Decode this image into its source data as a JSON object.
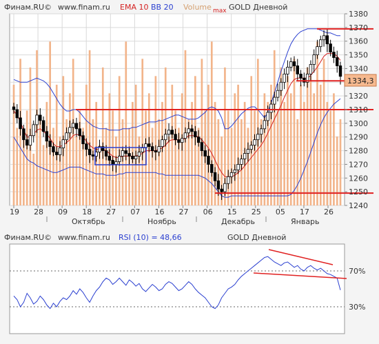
{
  "colors": {
    "background": "#f4f4f4",
    "plot_bg": "#ffffff",
    "grid": "#d9d9d9",
    "axis": "#888888",
    "text": "#333333",
    "ema": "#d42020",
    "bb": "#2a3fd0",
    "volume": "#f2b48a",
    "support_line": "#e02020",
    "rsi": "#2a3fd0",
    "highlight_box": "#2a3fd0",
    "price_box_bg": "#f6b98f"
  },
  "price_panel": {
    "header": {
      "site1": "Финам.RU©",
      "site2": "www.finam.ru",
      "ema_label": "EMA 10",
      "bb_label": "BB 20",
      "volume_label": "Volume",
      "max_label": "max",
      "instrument": "GOLD Дневной"
    },
    "last_price": "1334,3",
    "y_ticks": [
      "1380",
      "1370",
      "1360",
      "1350",
      "1340",
      "1330",
      "1320",
      "1310",
      "1300",
      "1290",
      "1280",
      "1270",
      "1260",
      "1250",
      "1240"
    ],
    "x_day_ticks": [
      "19",
      "28",
      "09",
      "18",
      "27",
      "07",
      "16",
      "27",
      "06",
      "15",
      "25",
      "05",
      "17",
      "26"
    ],
    "x_month_labels": [
      "Октябрь",
      "Ноябрь",
      "Декабрь",
      "Январь"
    ]
  },
  "rsi_panel": {
    "header": {
      "site1": "Финам.RU©",
      "site2": "www.finam.ru",
      "rsi_label": "RSI (10) = 48,66",
      "instrument": "GOLD Дневной"
    },
    "levels": [
      "70%",
      "30%"
    ]
  },
  "chart_data": [
    {
      "type": "candlestick",
      "title": "GOLD Дневной",
      "ylim": [
        1240,
        1380
      ],
      "x_ticks": [
        "19",
        "28",
        "09",
        "18",
        "27",
        "07",
        "16",
        "27",
        "06",
        "15",
        "25",
        "05",
        "17",
        "26"
      ],
      "months": [
        "Октябрь",
        "Ноябрь",
        "Декабрь",
        "Январь"
      ],
      "closes": [
        1310,
        1304,
        1296,
        1288,
        1284,
        1291,
        1299,
        1306,
        1302,
        1294,
        1287,
        1283,
        1279,
        1277,
        1282,
        1288,
        1293,
        1297,
        1300,
        1296,
        1291,
        1285,
        1281,
        1277,
        1276,
        1279,
        1283,
        1280,
        1276,
        1273,
        1270,
        1272,
        1276,
        1280,
        1278,
        1276,
        1274,
        1276,
        1279,
        1282,
        1285,
        1283,
        1280,
        1279,
        1283,
        1288,
        1292,
        1295,
        1292,
        1288,
        1286,
        1289,
        1293,
        1296,
        1294,
        1290,
        1286,
        1280,
        1276,
        1270,
        1264,
        1258,
        1252,
        1250,
        1256,
        1261,
        1264,
        1266,
        1270,
        1274,
        1278,
        1281,
        1284,
        1288,
        1292,
        1296,
        1302,
        1308,
        1314,
        1319,
        1324,
        1330,
        1336,
        1341,
        1345,
        1342,
        1336,
        1333,
        1330,
        1336,
        1343,
        1350,
        1356,
        1361,
        1364,
        1358,
        1352,
        1348,
        1342,
        1334.3
      ],
      "ema_10": [
        1309,
        1306,
        1301,
        1295,
        1290,
        1290,
        1292,
        1295,
        1296,
        1294,
        1292,
        1289,
        1285,
        1283,
        1283,
        1284,
        1286,
        1288,
        1291,
        1292,
        1291,
        1290,
        1287,
        1284,
        1282,
        1281,
        1281,
        1281,
        1280,
        1278,
        1276,
        1275,
        1275,
        1276,
        1276,
        1276,
        1276,
        1276,
        1277,
        1278,
        1280,
        1280,
        1280,
        1280,
        1281,
        1282,
        1284,
        1287,
        1288,
        1288,
        1288,
        1288,
        1289,
        1291,
        1291,
        1291,
        1290,
        1288,
        1285,
        1282,
        1278,
        1273,
        1268,
        1264,
        1261,
        1261,
        1261,
        1262,
        1264,
        1266,
        1269,
        1272,
        1275,
        1278,
        1281,
        1284,
        1288,
        1293,
        1298,
        1303,
        1308,
        1313,
        1319,
        1324,
        1329,
        1332,
        1333,
        1333,
        1333,
        1333,
        1335,
        1338,
        1341,
        1345,
        1349,
        1351,
        1351,
        1351,
        1349,
        1346
      ],
      "bb_upper": [
        1332,
        1331,
        1330,
        1330,
        1330,
        1331,
        1332,
        1333,
        1332,
        1331,
        1329,
        1326,
        1322,
        1318,
        1314,
        1311,
        1309,
        1309,
        1310,
        1310,
        1308,
        1305,
        1302,
        1300,
        1298,
        1297,
        1296,
        1296,
        1296,
        1295,
        1295,
        1295,
        1295,
        1296,
        1296,
        1296,
        1297,
        1297,
        1298,
        1299,
        1300,
        1301,
        1301,
        1301,
        1302,
        1302,
        1303,
        1304,
        1305,
        1306,
        1306,
        1305,
        1304,
        1303,
        1303,
        1303,
        1304,
        1306,
        1308,
        1311,
        1312,
        1311,
        1309,
        1304,
        1296,
        1296,
        1298,
        1301,
        1304,
        1307,
        1309,
        1311,
        1312,
        1312,
        1310,
        1307,
        1304,
        1308,
        1315,
        1322,
        1330,
        1338,
        1345,
        1352,
        1358,
        1362,
        1365,
        1367,
        1368,
        1369,
        1369,
        1369,
        1369,
        1368,
        1367,
        1366,
        1366,
        1365,
        1364,
        1364
      ],
      "bb_lower": [
        1290,
        1286,
        1282,
        1278,
        1274,
        1272,
        1271,
        1269,
        1268,
        1267,
        1266,
        1265,
        1264,
        1264,
        1265,
        1266,
        1267,
        1268,
        1268,
        1268,
        1268,
        1267,
        1266,
        1265,
        1264,
        1263,
        1263,
        1263,
        1262,
        1262,
        1262,
        1262,
        1263,
        1263,
        1264,
        1264,
        1264,
        1264,
        1264,
        1264,
        1264,
        1264,
        1264,
        1264,
        1263,
        1263,
        1262,
        1262,
        1262,
        1262,
        1262,
        1262,
        1262,
        1262,
        1262,
        1262,
        1262,
        1261,
        1260,
        1258,
        1256,
        1253,
        1250,
        1247,
        1246,
        1246,
        1247,
        1247,
        1247,
        1247,
        1247,
        1247,
        1247,
        1247,
        1247,
        1247,
        1247,
        1247,
        1247,
        1247,
        1247,
        1247,
        1247,
        1247,
        1248,
        1251,
        1255,
        1260,
        1266,
        1272,
        1279,
        1286,
        1293,
        1299,
        1304,
        1308,
        1311,
        1314,
        1316,
        1318
      ],
      "volume_pct": [
        70,
        45,
        85,
        40,
        55,
        80,
        30,
        90,
        50,
        35,
        60,
        95,
        45,
        70,
        40,
        75,
        50,
        65,
        85,
        40,
        55,
        45,
        70,
        90,
        50,
        60,
        35,
        80,
        45,
        65,
        55,
        40,
        75,
        50,
        95,
        45,
        60,
        70,
        40,
        85,
        55,
        65,
        45,
        75,
        50,
        60,
        80,
        40,
        70,
        55,
        45,
        65,
        90,
        50,
        60,
        75,
        45,
        85,
        55,
        70,
        95,
        60,
        50,
        40,
        80,
        55,
        45,
        65,
        70,
        50,
        60,
        45,
        75,
        55,
        85,
        50,
        65,
        60,
        70,
        90,
        55,
        80,
        60,
        75,
        65,
        85,
        50,
        70,
        60,
        80,
        75,
        65,
        95,
        70,
        85,
        60,
        55,
        65,
        40,
        50
      ],
      "hlines": [
        1310,
        1249,
        1331,
        1369
      ],
      "ema_label": "EMA 10",
      "bb_label": "BB 20",
      "last_price": 1334.3
    },
    {
      "type": "line",
      "title": "GOLD Дневной",
      "series_name": "RSI (10)",
      "ylim": [
        0,
        100
      ],
      "levels": [
        70,
        30
      ],
      "values": [
        42,
        38,
        30,
        35,
        45,
        40,
        33,
        36,
        42,
        38,
        32,
        28,
        34,
        30,
        36,
        40,
        38,
        42,
        48,
        44,
        50,
        46,
        40,
        35,
        42,
        48,
        52,
        58,
        62,
        60,
        55,
        58,
        62,
        58,
        54,
        60,
        57,
        53,
        56,
        50,
        47,
        51,
        55,
        52,
        48,
        50,
        55,
        58,
        56,
        52,
        48,
        50,
        54,
        58,
        55,
        50,
        46,
        43,
        40,
        35,
        30,
        28,
        32,
        40,
        45,
        50,
        52,
        55,
        60,
        64,
        67,
        70,
        73,
        76,
        79,
        82,
        85,
        86,
        83,
        80,
        78,
        76,
        79,
        80,
        77,
        74,
        76,
        72,
        70,
        74,
        76,
        73,
        71,
        73,
        70,
        67,
        66,
        64,
        62,
        48.66
      ],
      "last": 48.66
    }
  ]
}
